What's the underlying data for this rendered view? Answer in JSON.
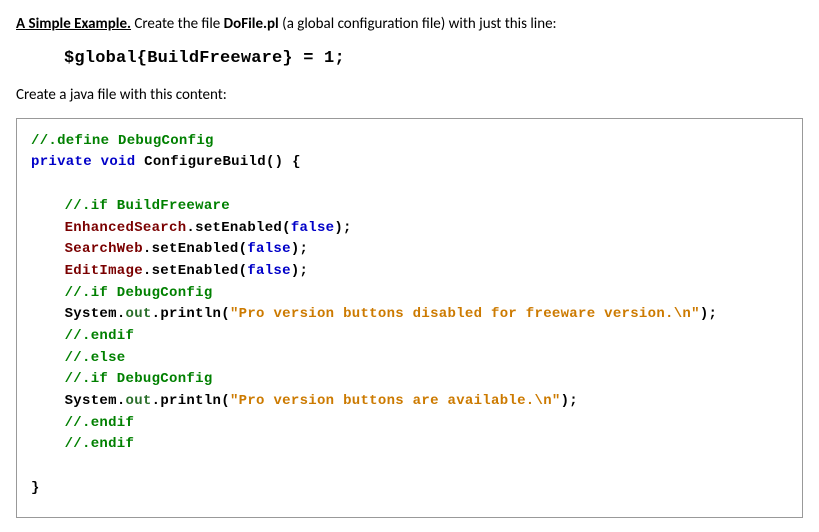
{
  "intro": {
    "heading": "A Simple Example.",
    "sentence_part1": "  Create the file ",
    "filename": "DoFile.pl",
    "sentence_part2": " (a global configuration file) with just this line:"
  },
  "config_line": "$global{BuildFreeware} = 1;",
  "para2": "Create a java file with this content:",
  "code": {
    "l01_comment": "//.define DebugConfig",
    "l02_kw1": "private",
    "l02_kw2": "void",
    "l02_name": "ConfigureBuild",
    "l02_rest": "() {",
    "l04_comment": "//.if BuildFreeware",
    "l05_obj": "EnhancedSearch",
    "l05_method": "setEnabled",
    "l05_arg": "false",
    "l06_obj": "SearchWeb",
    "l06_method": "setEnabled",
    "l06_arg": "false",
    "l07_obj": "EditImage",
    "l07_method": "setEnabled",
    "l07_arg": "false",
    "l08_comment": "//.if DebugConfig",
    "l09_class": "System",
    "l09_out": "out",
    "l09_method": "println",
    "l09_string": "\"Pro version buttons disabled for freeware version.\\n\"",
    "l10_comment": "//.endif",
    "l11_comment": "//.else",
    "l12_comment": "//.if DebugConfig",
    "l13_class": "System",
    "l13_out": "out",
    "l13_method": "println",
    "l13_string": "\"Pro version buttons are available.\\n\"",
    "l14_comment": "//.endif",
    "l15_comment": "//.endif",
    "l17_brace": "}"
  }
}
